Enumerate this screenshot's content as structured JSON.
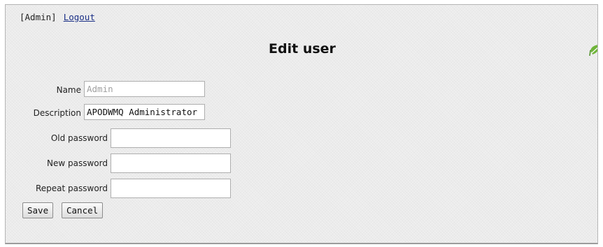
{
  "nav": {
    "user": "[Admin]",
    "logout": "Logout"
  },
  "page": {
    "title": "Edit user"
  },
  "form": {
    "name": {
      "label": "Name",
      "value": "Admin"
    },
    "description": {
      "label": "Description",
      "value": "APODWMQ Administrator"
    },
    "old_password": {
      "label": "Old password",
      "value": ""
    },
    "new_password": {
      "label": "New password",
      "value": ""
    },
    "repeat_password": {
      "label": "Repeat password",
      "value": ""
    },
    "save_label": "Save",
    "cancel_label": "Cancel"
  },
  "colors": {
    "link": "#1a2f86",
    "leaf_icon": "#6fb43a"
  },
  "icons": {
    "corner": "leaf-icon"
  }
}
